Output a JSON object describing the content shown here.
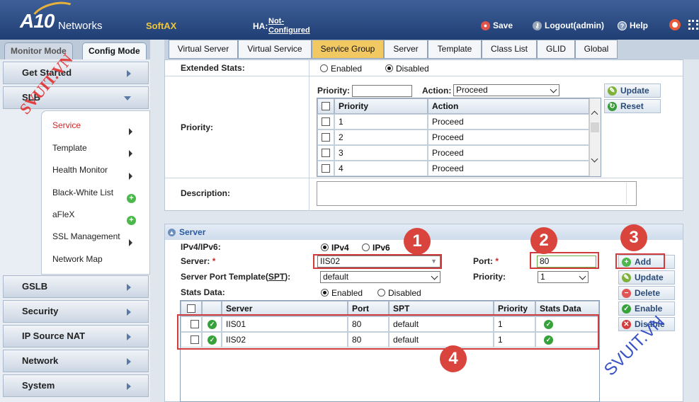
{
  "header": {
    "logo_main": "A10",
    "logo_sub": "Networks",
    "product": "SoftAX",
    "ha_label": "HA:",
    "ha_value": "Not-Configured",
    "save": "Save",
    "logout": "Logout(admin)",
    "help": "Help"
  },
  "mode_tabs": {
    "monitor": "Monitor Mode",
    "config": "Config Mode"
  },
  "top_tabs": [
    "Virtual Server",
    "Virtual Service",
    "Service Group",
    "Server",
    "Template",
    "Class List",
    "GLID",
    "Global"
  ],
  "active_top_tab": "Service Group",
  "sidebar": {
    "main": [
      "Get Started",
      "SLB",
      "GSLB",
      "Security",
      "IP Source NAT",
      "Network",
      "System"
    ],
    "slb_sub": [
      "Service",
      "Template",
      "Health Monitor",
      "Black-White List",
      "aFleX",
      "SSL Management",
      "Network Map"
    ]
  },
  "extended_stats": {
    "label": "Extended Stats:",
    "opt_enabled": "Enabled",
    "opt_disabled": "Disabled",
    "selected": "Disabled"
  },
  "priority": {
    "label": "Priority:",
    "priority_field_label": "Priority:",
    "priority_value": "",
    "action_label": "Action:",
    "action_value": "Proceed",
    "update": "Update",
    "reset": "Reset",
    "col_priority": "Priority",
    "col_action": "Action",
    "rows": [
      {
        "priority": "1",
        "action": "Proceed"
      },
      {
        "priority": "2",
        "action": "Proceed"
      },
      {
        "priority": "3",
        "action": "Proceed"
      },
      {
        "priority": "4",
        "action": "Proceed"
      }
    ]
  },
  "description": {
    "label": "Description:",
    "value": ""
  },
  "server_section": {
    "title": "Server",
    "ipv_label": "IPv4/IPv6:",
    "opt_ipv4": "IPv4",
    "opt_ipv6": "IPv6",
    "server_label": "Server:",
    "server_value": "IIS02",
    "port_label": "Port:",
    "port_value": "80",
    "spt_label_pre": "Server Port Template(",
    "spt_label_abbr": "SPT",
    "spt_label_post": "):",
    "spt_value": "default",
    "priority_label": "Priority:",
    "priority_value": "1",
    "stats_label": "Stats Data:",
    "stats_enabled": "Enabled",
    "stats_disabled": "Disabled",
    "required": "*",
    "buttons": {
      "add": "Add",
      "update": "Update",
      "delete": "Delete",
      "enable": "Enable",
      "disable": "Disable"
    },
    "columns": [
      "Server",
      "Port",
      "SPT",
      "Priority",
      "Stats Data"
    ],
    "rows": [
      {
        "server": "IIS01",
        "port": "80",
        "spt": "default",
        "priority": "1"
      },
      {
        "server": "IIS02",
        "port": "80",
        "spt": "default",
        "priority": "1"
      }
    ]
  },
  "annotations": [
    "1",
    "2",
    "3",
    "4"
  ],
  "watermarks": {
    "left": "SVUIT.VN",
    "right": "SVUIT.VN"
  },
  "colors": {
    "header": "#2b4d86",
    "active_tab": "#f2c863",
    "highlight": "#d23b3b",
    "ok": "#36a23a"
  }
}
